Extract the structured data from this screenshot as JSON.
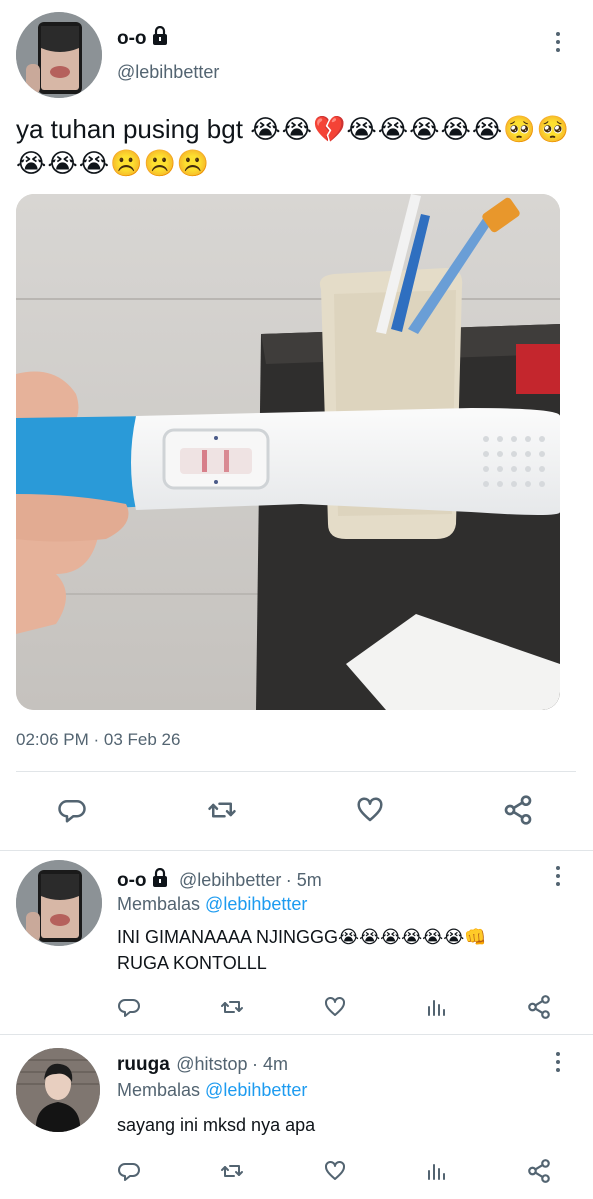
{
  "main_tweet": {
    "display_name": "o-o",
    "handle": "@lebihbetter",
    "text": "ya tuhan pusing bgt",
    "emojis_line1": "😭😭💔😭😭😭😭😭🥺🥺",
    "emojis_line2": "😭😭😭☹️☹️☹️",
    "timestamp": "02:06 PM · 03 Feb 26"
  },
  "replies": [
    {
      "display_name": "o-o",
      "handle": "@lebihbetter",
      "time": "· 5m",
      "replying_prefix": "Membalas",
      "replying_to": "@lebihbetter",
      "text_line1": "INI GIMANAAAA NJINGGG😭😭😭😭😭😭👊",
      "text_line2": "RUGA KONTOLLL"
    },
    {
      "display_name": "ruuga",
      "handle": "@hitstop",
      "time": "· 4m",
      "replying_prefix": "Membalas",
      "replying_to": "@lebihbetter",
      "text_line1": "sayang ini mksd nya apa",
      "text_line2": ""
    }
  ],
  "icons": {
    "reply": "reply-icon",
    "retweet": "retweet-icon",
    "like": "heart-icon",
    "share": "share-icon",
    "views": "views-icon",
    "more": "more-vertical-icon",
    "lock": "lock-icon"
  },
  "colors": {
    "text": "#0f1419",
    "secondary": "#536471",
    "link": "#1d9bf0",
    "divider": "#e1e5e8",
    "test_blue": "#2a9ad8"
  }
}
